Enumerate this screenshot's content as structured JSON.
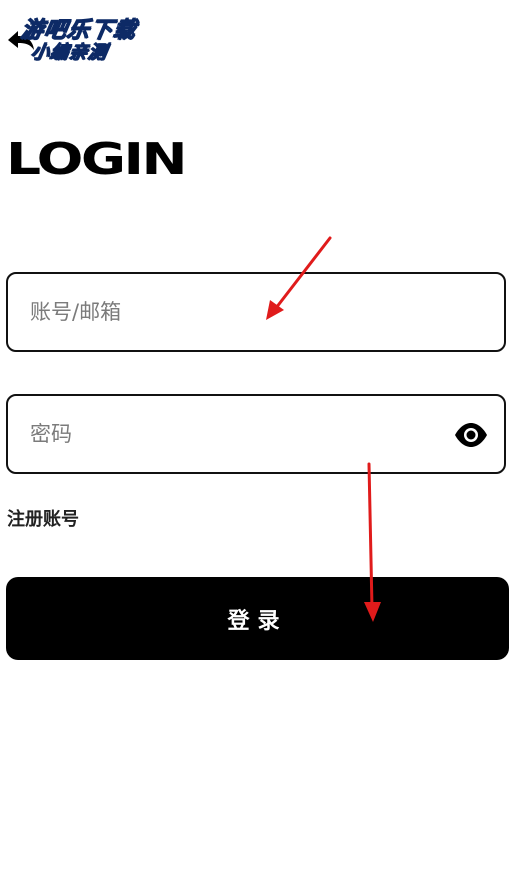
{
  "watermark": {
    "line1": "游吧乐下载",
    "line2": "小编亲测"
  },
  "header": {
    "back_icon": "back-arrow-icon",
    "logo_text": "LOGIN"
  },
  "form": {
    "account_placeholder": "账号/邮箱",
    "account_value": "",
    "password_placeholder": "密码",
    "password_value": "",
    "password_toggle_icon": "eye-icon",
    "register_label": "注册账号",
    "login_label": "登录"
  },
  "colors": {
    "accent": "#000000",
    "watermark": "#29d6ef",
    "annotation_arrow": "#e01b1b"
  }
}
